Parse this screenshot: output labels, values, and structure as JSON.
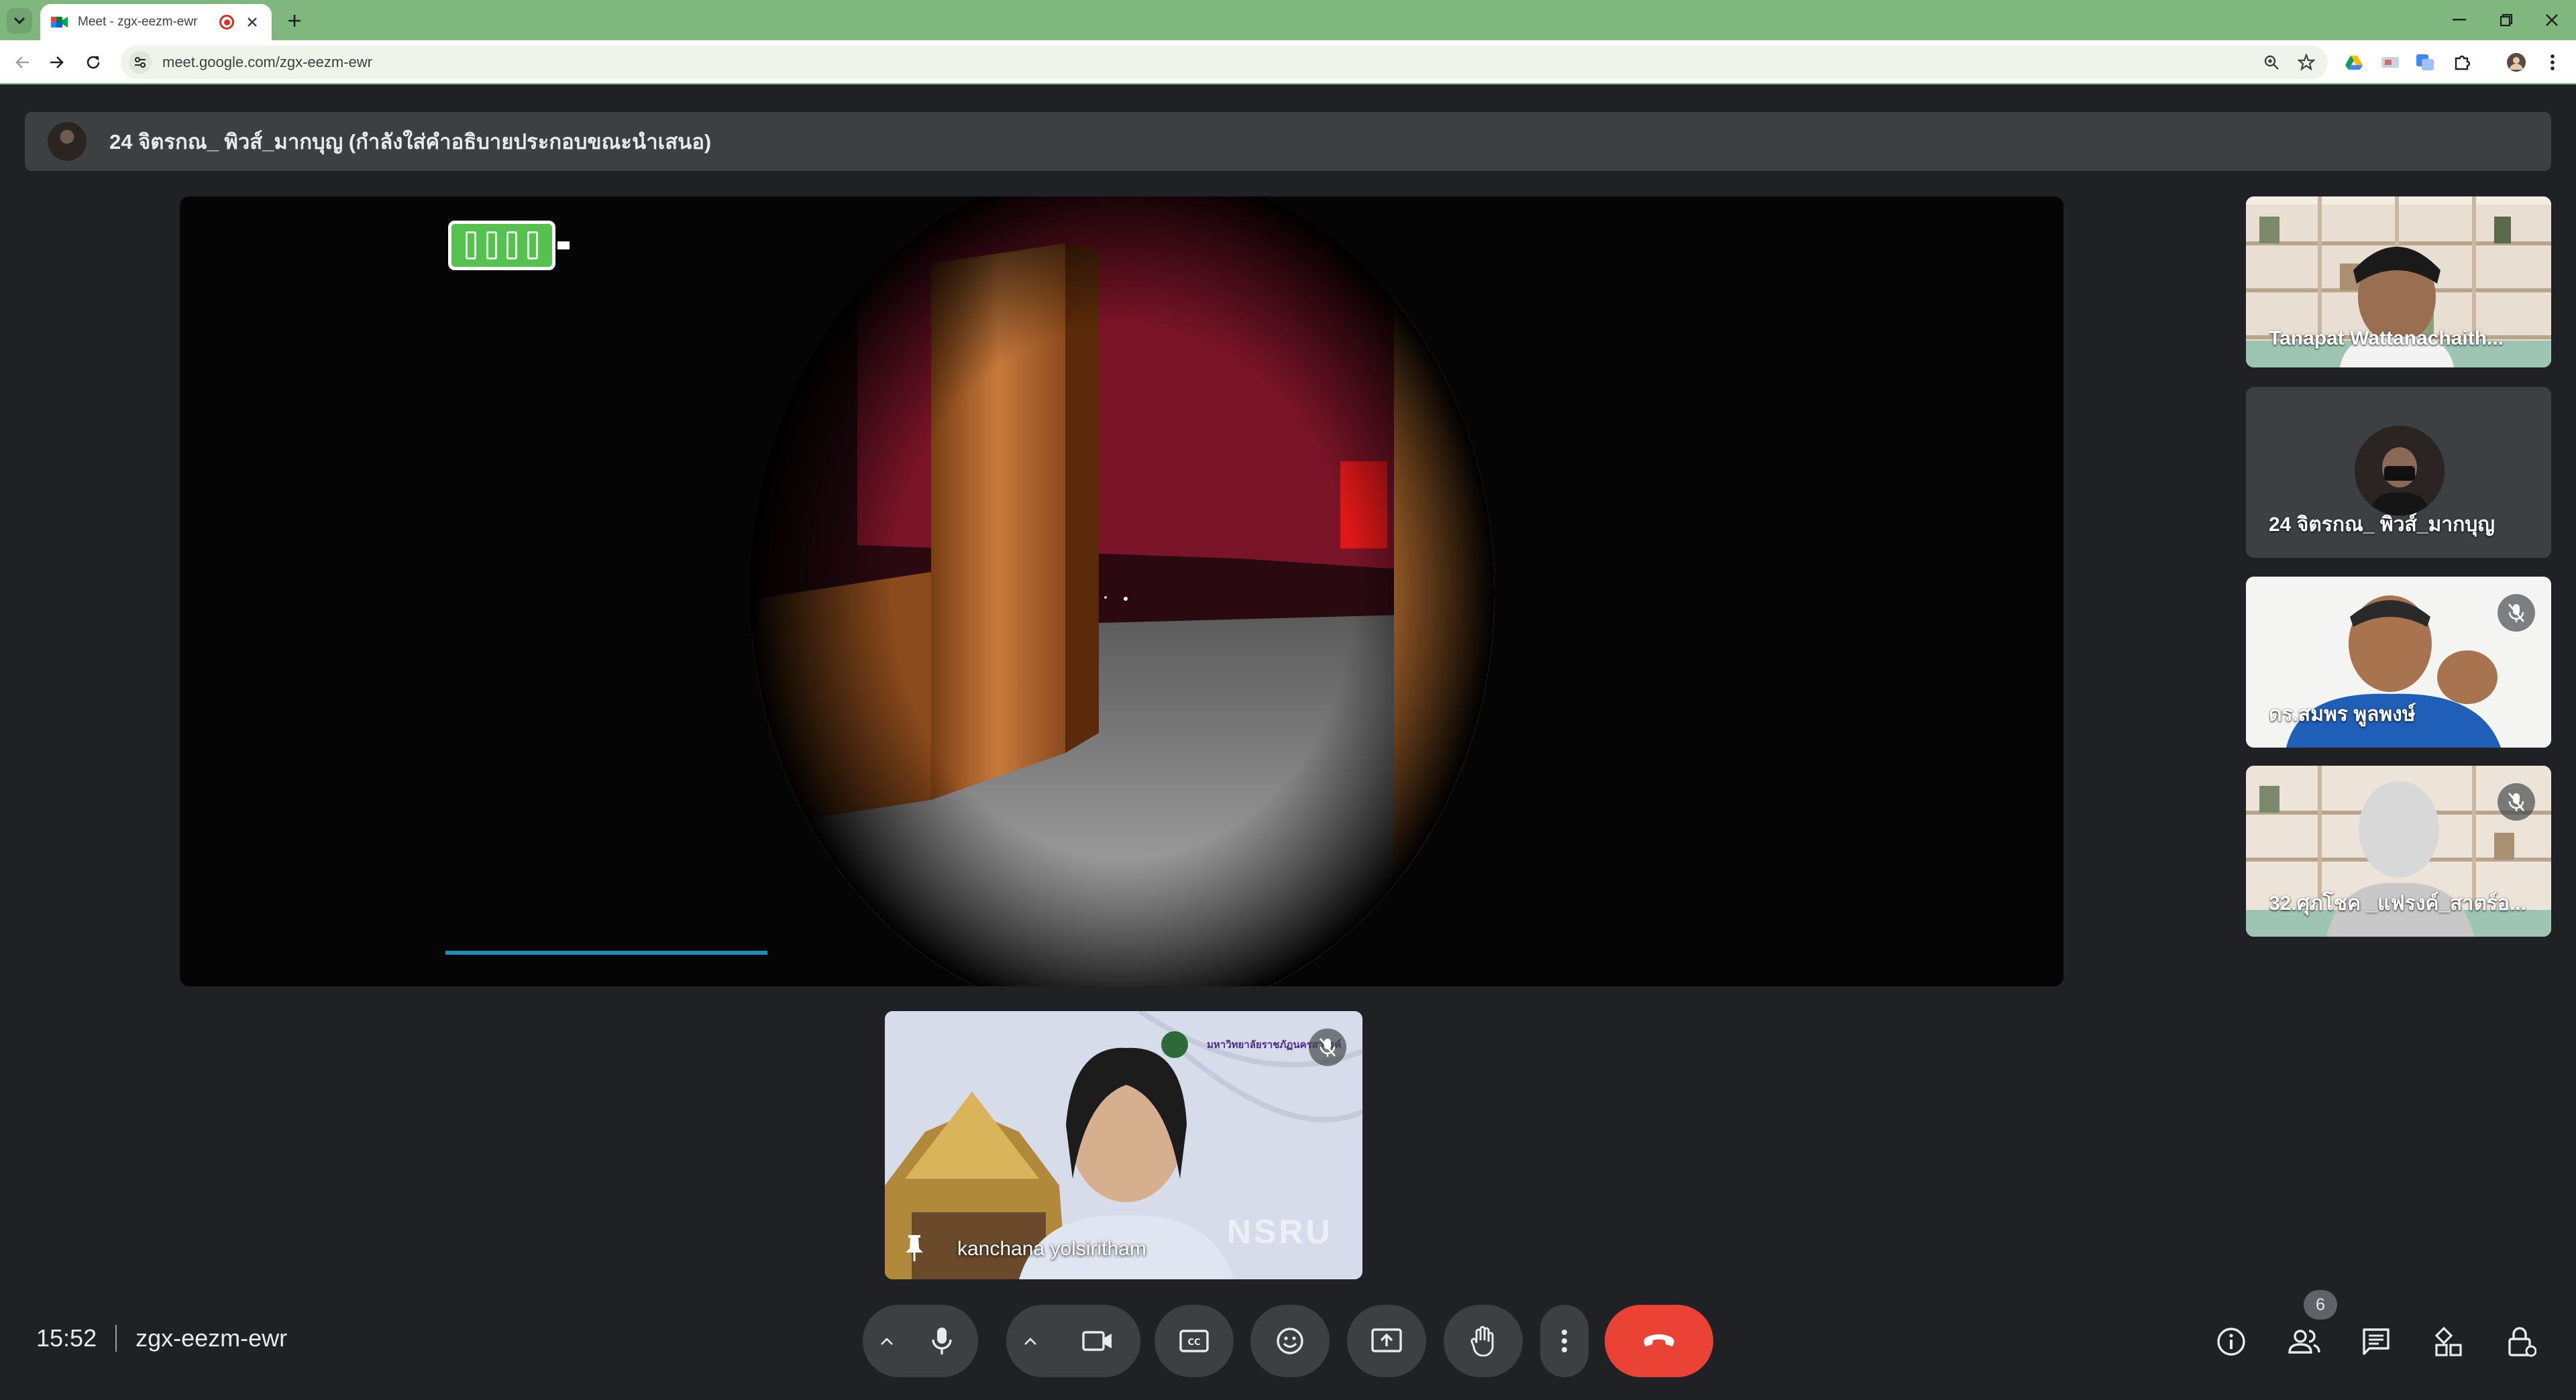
{
  "browser": {
    "tab_title": "Meet - zgx-eezm-ewr",
    "url": "meet.google.com/zgx-eezm-ewr",
    "colors": {
      "frame": "#7fb77e",
      "toolbar": "#ffffff"
    },
    "icons": [
      "tab-search-icon",
      "google-meet-favicon",
      "recording-icon",
      "close-icon",
      "plus-icon",
      "minimize-icon",
      "restore-icon",
      "close-window-icon",
      "back-icon",
      "forward-icon",
      "reload-icon",
      "site-info-icon",
      "zoom-icon",
      "bookmark-star-icon",
      "google-drive-icon",
      "extension-icons",
      "puzzle-icon",
      "profile-icon",
      "more-vert-icon"
    ]
  },
  "meet": {
    "presentation_banner": "24 จิตรกณ_ พิวส์_มากบุญ (กำลังใส่คำอธิบายประกอบขณะนำเสนอ)",
    "participants": [
      {
        "name": "Tanapat Wattanachaith...",
        "muted": false
      },
      {
        "name": "24 จิตรกณ_ พิวส์_มากบุญ",
        "muted": false
      },
      {
        "name": "ดร.สมพร พูลพงษ์",
        "muted": true
      },
      {
        "name": "32.ศุภโชค _แฟรงค์_สาตร์อ...",
        "muted": true
      }
    ],
    "pinned": {
      "name": "kanchana yolsiritham",
      "muted": true,
      "logo_text": "มหาวิทยาลัยราชภัฏนครสวรรค์",
      "watermark": "NSRU"
    },
    "time": "15:52",
    "meeting_code": "zgx-eezm-ewr",
    "people_count": "6",
    "end_call_color": "#ea4335",
    "controls": [
      "mic-icon",
      "camera-icon",
      "captions-icon",
      "emoji-icon",
      "present-icon",
      "raise-hand-icon",
      "more-options-icon",
      "end-call-icon"
    ],
    "right_controls": [
      "info-icon",
      "people-icon",
      "chat-icon",
      "activities-icon",
      "host-controls-icon"
    ]
  }
}
